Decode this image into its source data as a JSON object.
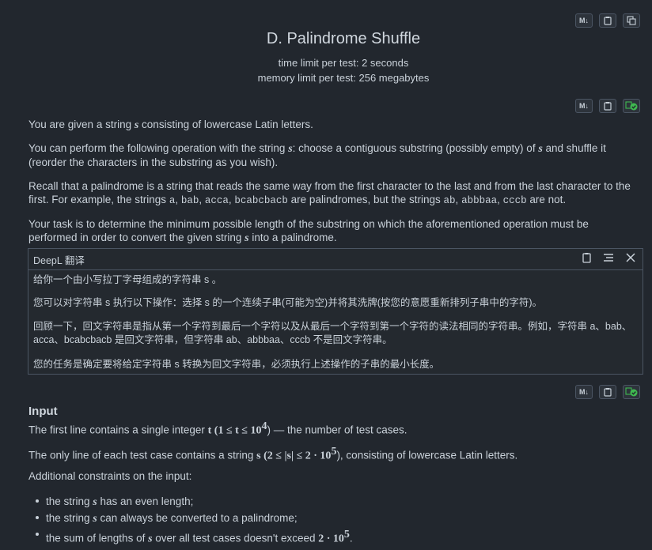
{
  "problem": {
    "title": "D. Palindrome Shuffle",
    "time_limit": "time limit per test: 2 seconds",
    "memory_limit": "memory limit per test: 256 megabytes"
  },
  "toolbar": {
    "md_label": "M↓"
  },
  "statement": {
    "p1a": "You are given a string ",
    "p1b": " consisting of lowercase Latin letters.",
    "p2a": "You can perform the following operation with the string ",
    "p2b": ": choose a contiguous substring (possibly empty) of ",
    "p2c": " and shuffle it (reorder the characters in the substring as you wish).",
    "p3a": "Recall that a palindrome is a string that reads the same way from the first character to the last and from the last character to the first. For example, the strings ",
    "p3_pal": [
      "a",
      "bab",
      "acca",
      "bcabcbacb"
    ],
    "p3b": " are palindromes, but the strings ",
    "p3_nonpal": [
      "ab",
      "abbbaa",
      "cccb"
    ],
    "p3c": " are not.",
    "p4a": "Your task is to determine the minimum possible length of the substring on which the aforementioned operation must be performed in order to convert the given string ",
    "p4b": " into a palindrome.",
    "var_s": "s"
  },
  "deepl": {
    "label": "DeepL 翻译",
    "z1": "给你一个由小写拉丁字母组成的字符串  s  。",
    "z2": "您可以对字符串  s  执行以下操作：选择  s  的一个连续子串(可能为空)并将其洗牌(按您的意愿重新排列子串中的字符)。",
    "z3": "回顾一下，回文字符串是指从第一个字符到最后一个字符以及从最后一个字符到第一个字符的读法相同的字符串。例如，字符串 a、bab、acca、bcabcbacb 是回文字符串，但字符串 ab、abbbaa、cccb 不是回文字符串。",
    "z4": "您的任务是确定要将给定字符串  s  转换为回文字符串，必须执行上述操作的子串的最小长度。"
  },
  "input": {
    "heading": "Input",
    "l1a": "The first line contains a single integer ",
    "l1m": "t (1 ≤ t ≤ 10",
    "l1e": "4",
    "l1b": ") — the number of test cases.",
    "l2a": "The only line of each test case contains a string ",
    "l2m": "s (2 ≤ |s| ≤ 2 · 10",
    "l2e": "5",
    "l2b": "), consisting of lowercase Latin letters.",
    "l3": "Additional constraints on the input:",
    "b1a": "the string ",
    "b1b": " has an even length;",
    "b2a": "the string ",
    "b2b": " can always be converted to a palindrome;",
    "b3a": "the sum of lengths of ",
    "b3b": " over all test cases doesn't exceed ",
    "b3m": "2 · 10",
    "b3e": "5",
    "b3c": "."
  }
}
